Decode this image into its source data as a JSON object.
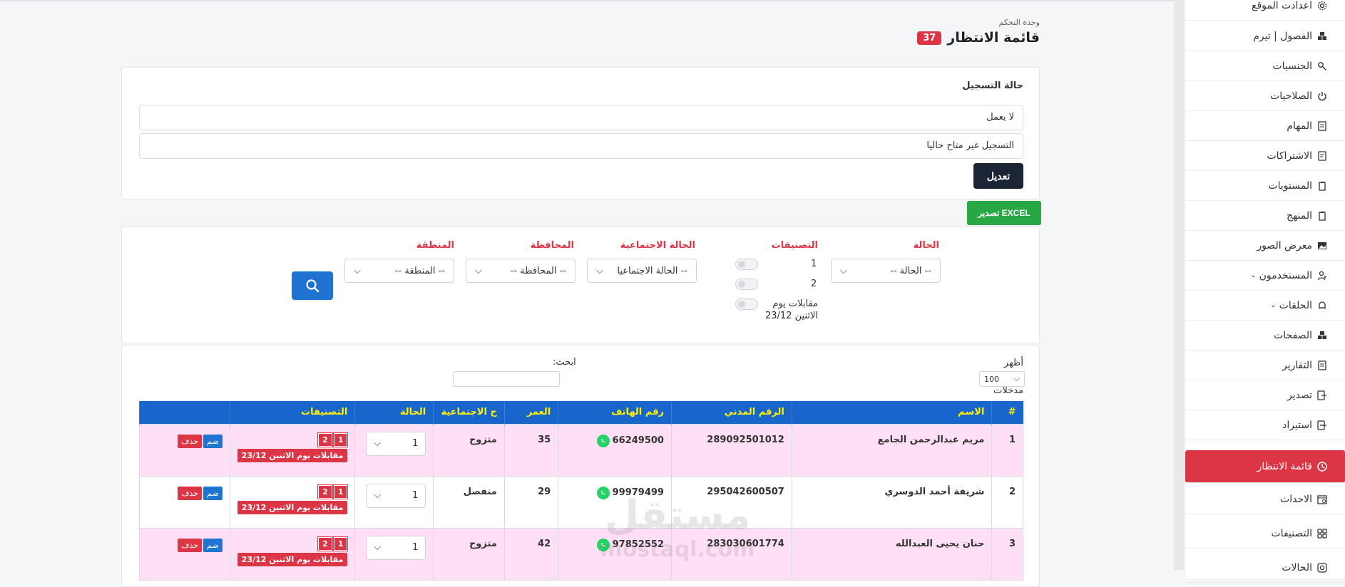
{
  "sidebar": {
    "items": [
      {
        "label": "اعدادت الموقع",
        "icon": "gear-icon"
      },
      {
        "label": "الفصول | تيرم",
        "icon": "cubes-icon"
      },
      {
        "label": "الجنسيات",
        "icon": "gender-icon"
      },
      {
        "label": "الصلاحيات",
        "icon": "power-icon"
      },
      {
        "label": "المهام",
        "icon": "document-icon"
      },
      {
        "label": "الاشتراكات",
        "icon": "invoice-icon"
      },
      {
        "label": "المستويات",
        "icon": "clipboard-icon"
      },
      {
        "label": "المنهج",
        "icon": "clipboard-icon"
      },
      {
        "label": "معرض الصور",
        "icon": "image-icon"
      },
      {
        "label": "المستخدمون",
        "icon": "user-add-icon"
      },
      {
        "label": "الحلقات",
        "icon": "bell-icon"
      },
      {
        "label": "الصفحات",
        "icon": "cubes-icon"
      },
      {
        "label": "التقارير",
        "icon": "report-icon"
      },
      {
        "label": "تصدير",
        "icon": "export-icon"
      },
      {
        "label": "استيراد",
        "icon": "import-icon"
      },
      {
        "label": "قائمة الانتظار",
        "icon": "clock-icon"
      },
      {
        "label": "الاحداث",
        "icon": "calendar-icon"
      },
      {
        "label": "التصنيفات",
        "icon": "grid-icon"
      },
      {
        "label": "الحالات",
        "icon": "instagram-icon"
      }
    ]
  },
  "header": {
    "subtitle": "وحدة التحكم",
    "title": "قائمة الانتظار",
    "count": "37"
  },
  "registration": {
    "title": "حالة التسجيل",
    "status_value": "لا يعمل",
    "message_value": "التسجيل غير متاح حاليا",
    "edit_label": "تعديل"
  },
  "export_label": "تصدير EXCEL",
  "filters": {
    "status_label": "الحالة",
    "status_placeholder": "-- الحالة --",
    "categories_label": "التصنيفات",
    "toggle_1": "1",
    "toggle_2": "2",
    "toggle_3_line1": "مقابلات يوم",
    "toggle_3_line2": "الاثنين 23/12",
    "social_label": "الحالة الاجتماعية",
    "social_placeholder": "-- الحالة الاجتماعيا",
    "governorate_label": "المحافظة",
    "governorate_placeholder": "-- المحافظة --",
    "region_label": "المنطقة",
    "region_placeholder": "-- المنطقة --"
  },
  "table_controls": {
    "show_label": "أظهر",
    "entries_label": "مدخلات",
    "page_size": "100",
    "search_label": "ابحث:"
  },
  "table": {
    "headers": [
      "#",
      "الاسم",
      "الرقم المدني",
      "رقم الهاتف",
      "العمر",
      "ح الاجتماعية",
      "الحالة",
      "التصنيفات",
      ""
    ],
    "rows": [
      {
        "n": "1",
        "name": "مريم عبدالرحمن الجامع",
        "civil": "289092501012",
        "phone": "66249500",
        "age": "35",
        "social": "متزوج",
        "status": "1",
        "tag1": "1",
        "tag2": "2",
        "day": "مقابلات يوم الاثنين 23/12",
        "join": "ضم",
        "del": "حذف"
      },
      {
        "n": "2",
        "name": "شريفة أحمد الدوسري",
        "civil": "295042600507",
        "phone": "99979499",
        "age": "29",
        "social": "منفصل",
        "status": "1",
        "tag1": "1",
        "tag2": "2",
        "day": "مقابلات يوم الاثنين 23/12",
        "join": "ضم",
        "del": "حذف"
      },
      {
        "n": "3",
        "name": "حنان يحيى العبدالله",
        "civil": "283030601774",
        "phone": "97852552",
        "age": "42",
        "social": "متزوج",
        "status": "1",
        "tag1": "1",
        "tag2": "2",
        "day": "مقابلات يوم الاثنين 23/12",
        "join": "ضم",
        "del": "حذف"
      }
    ]
  },
  "watermark": {
    "text_ar": "مستقل",
    "text_en": "mostaql.com"
  }
}
